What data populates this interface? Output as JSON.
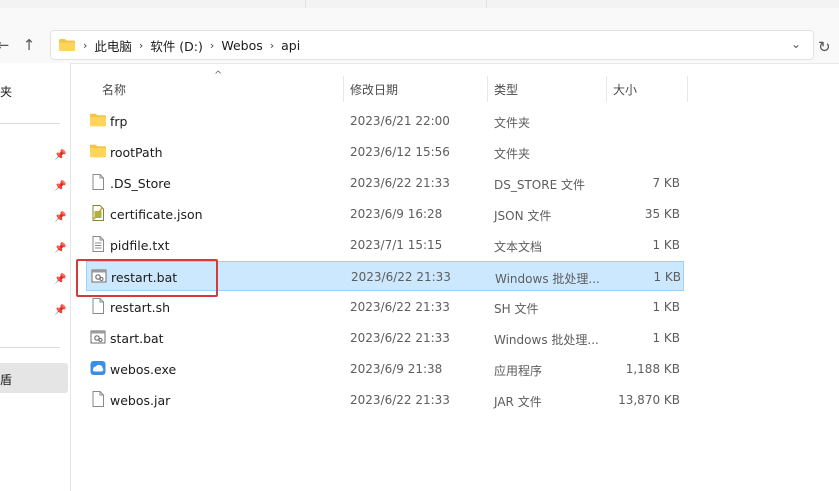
{
  "breadcrumb": [
    "此电脑",
    "软件 (D:)",
    "Webos",
    "api"
  ],
  "sidebar": {
    "partial_label_top": "夹",
    "selected_partial": "盾"
  },
  "columns": {
    "name": "名称",
    "date": "修改日期",
    "type": "类型",
    "size": "大小"
  },
  "files": [
    {
      "name": "frp",
      "date": "2023/6/21 22:00",
      "type": "文件夹",
      "size": "",
      "icon": "folder-icon"
    },
    {
      "name": "rootPath",
      "date": "2023/6/12 15:56",
      "type": "文件夹",
      "size": "",
      "icon": "folder-icon"
    },
    {
      "name": ".DS_Store",
      "date": "2023/6/22 21:33",
      "type": "DS_STORE 文件",
      "size": "7 KB",
      "icon": "file-icon"
    },
    {
      "name": "certificate.json",
      "date": "2023/6/9 16:28",
      "type": "JSON 文件",
      "size": "35 KB",
      "icon": "json-file-icon"
    },
    {
      "name": "pidfile.txt",
      "date": "2023/7/1 15:15",
      "type": "文本文档",
      "size": "1 KB",
      "icon": "text-file-icon"
    },
    {
      "name": "restart.bat",
      "date": "2023/6/22 21:33",
      "type": "Windows 批处理...",
      "size": "1 KB",
      "icon": "batch-file-icon",
      "selected": true
    },
    {
      "name": "restart.sh",
      "date": "2023/6/22 21:33",
      "type": "SH 文件",
      "size": "1 KB",
      "icon": "file-icon"
    },
    {
      "name": "start.bat",
      "date": "2023/6/22 21:33",
      "type": "Windows 批处理...",
      "size": "1 KB",
      "icon": "batch-file-icon"
    },
    {
      "name": "webos.exe",
      "date": "2023/6/9 21:38",
      "type": "应用程序",
      "size": "1,188 KB",
      "icon": "exe-icon"
    },
    {
      "name": "webos.jar",
      "date": "2023/6/22 21:33",
      "type": "JAR 文件",
      "size": "13,870 KB",
      "icon": "file-icon"
    }
  ],
  "colors": {
    "selection": "#cce8ff",
    "highlight_box": "#d63a3a",
    "folder": "#f4c542"
  }
}
